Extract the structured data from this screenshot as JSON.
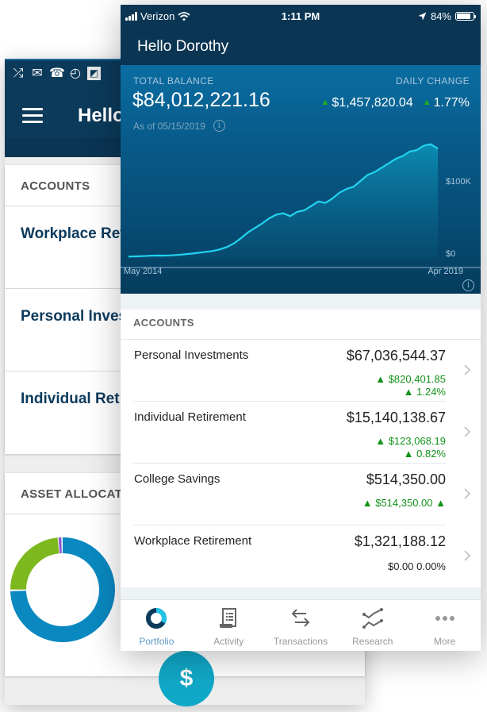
{
  "back_app": {
    "status_icons": [
      "shuffle-icon",
      "mail-icon",
      "missed-call-icon",
      "speedometer-icon",
      "flipboard-icon"
    ],
    "title": "Hello Dorothy",
    "accounts_header": "ACCOUNTS",
    "accounts": [
      "Workplace Retirement",
      "Personal Investments",
      "Individual Retirement"
    ],
    "asset_allocation_header": "ASSET ALLOCATION",
    "allocation_colors": {
      "primary": "#0a88c0",
      "secondary": "#7db81e",
      "tertiary": "#8a4fd0"
    },
    "fab_label": "$"
  },
  "status_bar": {
    "carrier": "Verizon",
    "time": "1:11 PM",
    "battery": "84%",
    "battery_level": 0.84
  },
  "header": {
    "greeting": "Hello Dorothy"
  },
  "summary": {
    "total_label": "TOTAL BALANCE",
    "total_value": "$84,012,221.16",
    "as_of": "As of 05/15/2019",
    "daily_label": "DAILY CHANGE",
    "daily_amount": "$1,457,820.04",
    "daily_percent": "1.77%",
    "up_symbol": "▲"
  },
  "chart_data": {
    "type": "area",
    "x_start_label": "May 2014",
    "x_end_label": "Apr 2019",
    "y_tick_labels": [
      "$0",
      "$100K"
    ],
    "ylim": [
      0,
      160000
    ],
    "values": [
      3000,
      3200,
      3600,
      4100,
      4400,
      4300,
      4600,
      5200,
      6100,
      7000,
      8200,
      9400,
      10600,
      12800,
      16000,
      21000,
      28000,
      36000,
      42000,
      48000,
      55000,
      60000,
      62000,
      58000,
      64000,
      66000,
      72000,
      78000,
      76000,
      82000,
      90000,
      95000,
      98000,
      106000,
      114000,
      118000,
      124000,
      130000,
      136000,
      140000,
      146000,
      148000,
      154000,
      156000,
      150000
    ]
  },
  "accounts": {
    "header": "ACCOUNTS",
    "rows": [
      {
        "name": "Personal Investments",
        "balance": "$67,036,544.37",
        "change_amount": "▲ $820,401.85",
        "change_percent": "▲ 1.24%"
      },
      {
        "name": "Individual Retirement",
        "balance": "$15,140,138.67",
        "change_amount": "▲ $123,068.19",
        "change_percent": "▲ 0.82%"
      },
      {
        "name": "College Savings",
        "balance": "$514,350.00",
        "change_amount": "▲ $514,350.00 ▲",
        "change_percent": ""
      },
      {
        "name": "Workplace Retirement",
        "balance": "$1,321,188.12",
        "change_amount": "$0.00 0.00%",
        "change_percent": ""
      }
    ]
  },
  "tabs": [
    {
      "label": "Portfolio",
      "icon": "portfolio-donut-icon",
      "active": true
    },
    {
      "label": "Activity",
      "icon": "document-list-icon",
      "active": false
    },
    {
      "label": "Transactions",
      "icon": "transfer-arrows-icon",
      "active": false
    },
    {
      "label": "Research",
      "icon": "research-chart-icon",
      "active": false
    },
    {
      "label": "More",
      "icon": "more-dots-icon",
      "active": false
    }
  ],
  "colors": {
    "nav_bg": "#0a3654",
    "positive": "#13921a",
    "chart_line": "#22d3f0",
    "active_tab": "#5e9ac6"
  }
}
